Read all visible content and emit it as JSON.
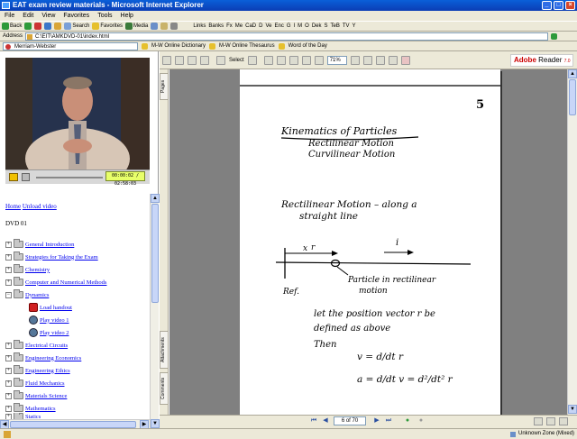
{
  "window": {
    "title": "EAT exam review materials - Microsoft Internet Explorer",
    "controls": [
      "_",
      "□",
      "×"
    ]
  },
  "menu": [
    "File",
    "Edit",
    "View",
    "Favorites",
    "Tools",
    "Help"
  ],
  "toolbar": {
    "back": "Back",
    "search": "Search",
    "favorites": "Favorites",
    "media": "Media"
  },
  "links_bar": {
    "links_label": "Links",
    "links": [
      "Banks",
      "Fx",
      "Me",
      "CaD",
      "D",
      "Ve",
      "Enc",
      "G",
      "I",
      "M",
      "O",
      "Dek",
      "S",
      "TeB",
      "TV",
      "Y"
    ]
  },
  "address": {
    "label": "Address",
    "value": "C:\\EIT\\AMKDVD-01\\index.html"
  },
  "mw_toolbar": {
    "brand": "Merriam-Webster",
    "buttons": [
      "M-W Online Dictionary",
      "M-W Online Thesaurus",
      "Word of the Day"
    ]
  },
  "video": {
    "timecode": "00:00:02 / 02:58:03"
  },
  "nav": {
    "home": "Home",
    "unload": "Unload video"
  },
  "dvd_label": "DVD 01",
  "tree": [
    {
      "label": "General Introduction",
      "expanded": false
    },
    {
      "label": "Strategies for Taking the Exam",
      "expanded": false
    },
    {
      "label": "Chemistry",
      "expanded": false
    },
    {
      "label": "Computer and Numerical Methods",
      "expanded": false
    },
    {
      "label": "Dynamics",
      "expanded": true
    },
    {
      "label": "Load handout",
      "child": true,
      "icon": "pdf-icon"
    },
    {
      "label": "Play video 1",
      "child": true,
      "icon": "film-icon"
    },
    {
      "label": "Play video 2",
      "child": true,
      "icon": "film-icon"
    },
    {
      "label": "Electrical Circuits",
      "expanded": false
    },
    {
      "label": "Engineering Economics",
      "expanded": false
    },
    {
      "label": "Engineering Ethics",
      "expanded": false
    },
    {
      "label": "Fluid Mechanics",
      "expanded": false
    },
    {
      "label": "Materials Science",
      "expanded": false
    },
    {
      "label": "Mathematics",
      "expanded": false
    },
    {
      "label": "Statics",
      "expanded": false
    }
  ],
  "reader": {
    "select_label": "Select",
    "zoom": "71%",
    "brand": "Adobe",
    "product": "Reader",
    "version": "7.0",
    "page_indicator": "6 of 70",
    "tabs": [
      "Pages",
      "Attachments",
      "Comments"
    ]
  },
  "handout": {
    "page_number": "5",
    "heading": "Kinematics of Particles",
    "subheadings": [
      "Rectilinear Motion",
      "Curvilinear Motion"
    ],
    "section": "Rectilinear Motion – along a",
    "section_cont": "straight line",
    "x_label": "x",
    "x_vector": "r",
    "unit_vector": "i",
    "origin_label": "Ref.",
    "particle_label": "Particle in rectilinear",
    "particle_label_cont": "motion",
    "text1": "let the position vector r be",
    "text2": "defined as above",
    "then": "Then",
    "eq1": "v = d/dt r",
    "eq2": "a = d/dt v = d²/dt² r"
  },
  "status": {
    "zone": "Unknown Zone (Mixed)"
  },
  "colors": {
    "titlebar": "#0b3db4",
    "link": "#0000ee",
    "timecode_bg": "#e8ff6a",
    "doc_bg": "#808080"
  }
}
